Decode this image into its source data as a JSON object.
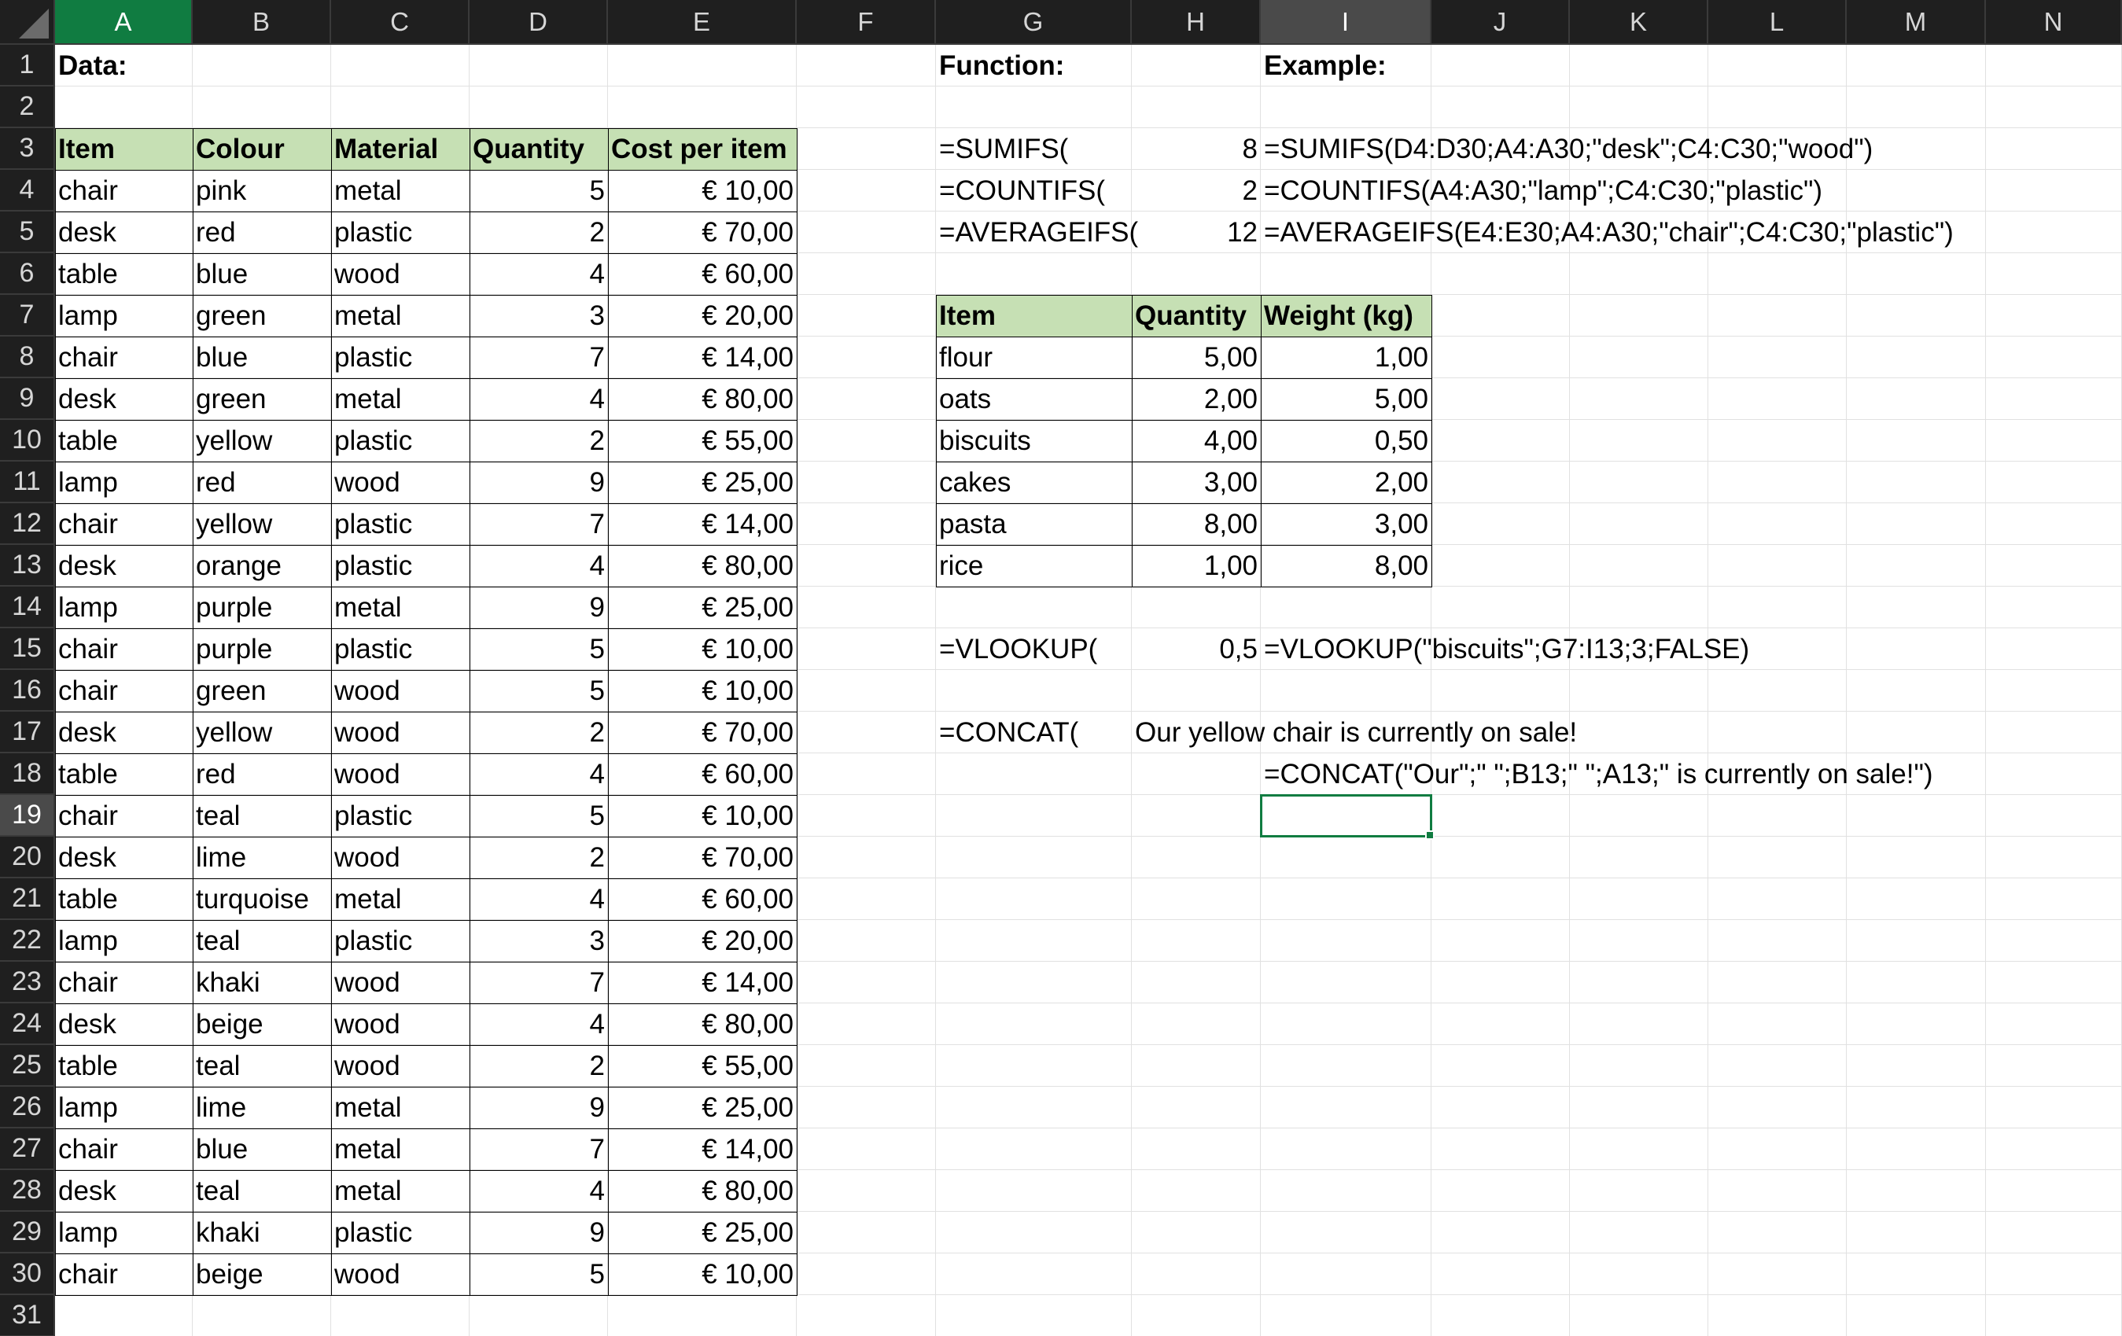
{
  "columns": [
    "A",
    "B",
    "C",
    "D",
    "E",
    "F",
    "G",
    "H",
    "I",
    "J",
    "K",
    "L",
    "M",
    "N"
  ],
  "rows": [
    "1",
    "2",
    "3",
    "4",
    "5",
    "6",
    "7",
    "8",
    "9",
    "10",
    "11",
    "12",
    "13",
    "14",
    "15",
    "16",
    "17",
    "18",
    "19",
    "20",
    "21",
    "22",
    "23",
    "24",
    "25",
    "26",
    "27",
    "28",
    "29",
    "30",
    "31"
  ],
  "active_cell": "I19",
  "colors": {
    "header_fill": "#c6e0b4",
    "active_header": "#107c41",
    "selection_border": "#107c41"
  },
  "labels": {
    "data": "Data:",
    "function": "Function:",
    "example": "Example:"
  },
  "data_table": {
    "headers": [
      "Item",
      "Colour",
      "Material",
      "Quantity",
      "Cost per item"
    ],
    "rows": [
      [
        "chair",
        "pink",
        "metal",
        "5",
        "€ 10,00"
      ],
      [
        "desk",
        "red",
        "plastic",
        "2",
        "€ 70,00"
      ],
      [
        "table",
        "blue",
        "wood",
        "4",
        "€ 60,00"
      ],
      [
        "lamp",
        "green",
        "metal",
        "3",
        "€ 20,00"
      ],
      [
        "chair",
        "blue",
        "plastic",
        "7",
        "€ 14,00"
      ],
      [
        "desk",
        "green",
        "metal",
        "4",
        "€ 80,00"
      ],
      [
        "table",
        "yellow",
        "plastic",
        "2",
        "€ 55,00"
      ],
      [
        "lamp",
        "red",
        "wood",
        "9",
        "€ 25,00"
      ],
      [
        "chair",
        "yellow",
        "plastic",
        "7",
        "€ 14,00"
      ],
      [
        "desk",
        "orange",
        "plastic",
        "4",
        "€ 80,00"
      ],
      [
        "lamp",
        "purple",
        "metal",
        "9",
        "€ 25,00"
      ],
      [
        "chair",
        "purple",
        "plastic",
        "5",
        "€ 10,00"
      ],
      [
        "chair",
        "green",
        "wood",
        "5",
        "€ 10,00"
      ],
      [
        "desk",
        "yellow",
        "wood",
        "2",
        "€ 70,00"
      ],
      [
        "table",
        "red",
        "wood",
        "4",
        "€ 60,00"
      ],
      [
        "chair",
        "teal",
        "plastic",
        "5",
        "€ 10,00"
      ],
      [
        "desk",
        "lime",
        "wood",
        "2",
        "€ 70,00"
      ],
      [
        "table",
        "turquoise",
        "metal",
        "4",
        "€ 60,00"
      ],
      [
        "lamp",
        "teal",
        "plastic",
        "3",
        "€ 20,00"
      ],
      [
        "chair",
        "khaki",
        "wood",
        "7",
        "€ 14,00"
      ],
      [
        "desk",
        "beige",
        "wood",
        "4",
        "€ 80,00"
      ],
      [
        "table",
        "teal",
        "wood",
        "2",
        "€ 55,00"
      ],
      [
        "lamp",
        "lime",
        "metal",
        "9",
        "€ 25,00"
      ],
      [
        "chair",
        "blue",
        "metal",
        "7",
        "€ 14,00"
      ],
      [
        "desk",
        "teal",
        "metal",
        "4",
        "€ 80,00"
      ],
      [
        "lamp",
        "khaki",
        "plastic",
        "9",
        "€ 25,00"
      ],
      [
        "chair",
        "beige",
        "wood",
        "5",
        "€ 10,00"
      ]
    ]
  },
  "functions": [
    {
      "name": "=SUMIFS(",
      "result": "8",
      "example": "=SUMIFS(D4:D30;A4:A30;\"desk\";C4:C30;\"wood\")"
    },
    {
      "name": "=COUNTIFS(",
      "result": "2",
      "example": "=COUNTIFS(A4:A30;\"lamp\";C4:C30;\"plastic\")"
    },
    {
      "name": "=AVERAGEIFS(",
      "result": "12",
      "example": "=AVERAGEIFS(E4:E30;A4:A30;\"chair\";C4:C30;\"plastic\")"
    }
  ],
  "weight_table": {
    "headers": [
      "Item",
      "Quantity",
      "Weight (kg)"
    ],
    "rows": [
      [
        "flour",
        "5,00",
        "1,00"
      ],
      [
        "oats",
        "2,00",
        "5,00"
      ],
      [
        "biscuits",
        "4,00",
        "0,50"
      ],
      [
        "cakes",
        "3,00",
        "2,00"
      ],
      [
        "pasta",
        "8,00",
        "3,00"
      ],
      [
        "rice",
        "1,00",
        "8,00"
      ]
    ]
  },
  "vlookup": {
    "name": "=VLOOKUP(",
    "result": "0,5",
    "example": "=VLOOKUP(\"biscuits\";G7:I13;3;FALSE)"
  },
  "concat": {
    "name": "=CONCAT(",
    "result": "Our yellow chair is currently on sale!",
    "example": "=CONCAT(\"Our\";\" \";B13;\" \";A13;\" is currently on sale!\")"
  }
}
